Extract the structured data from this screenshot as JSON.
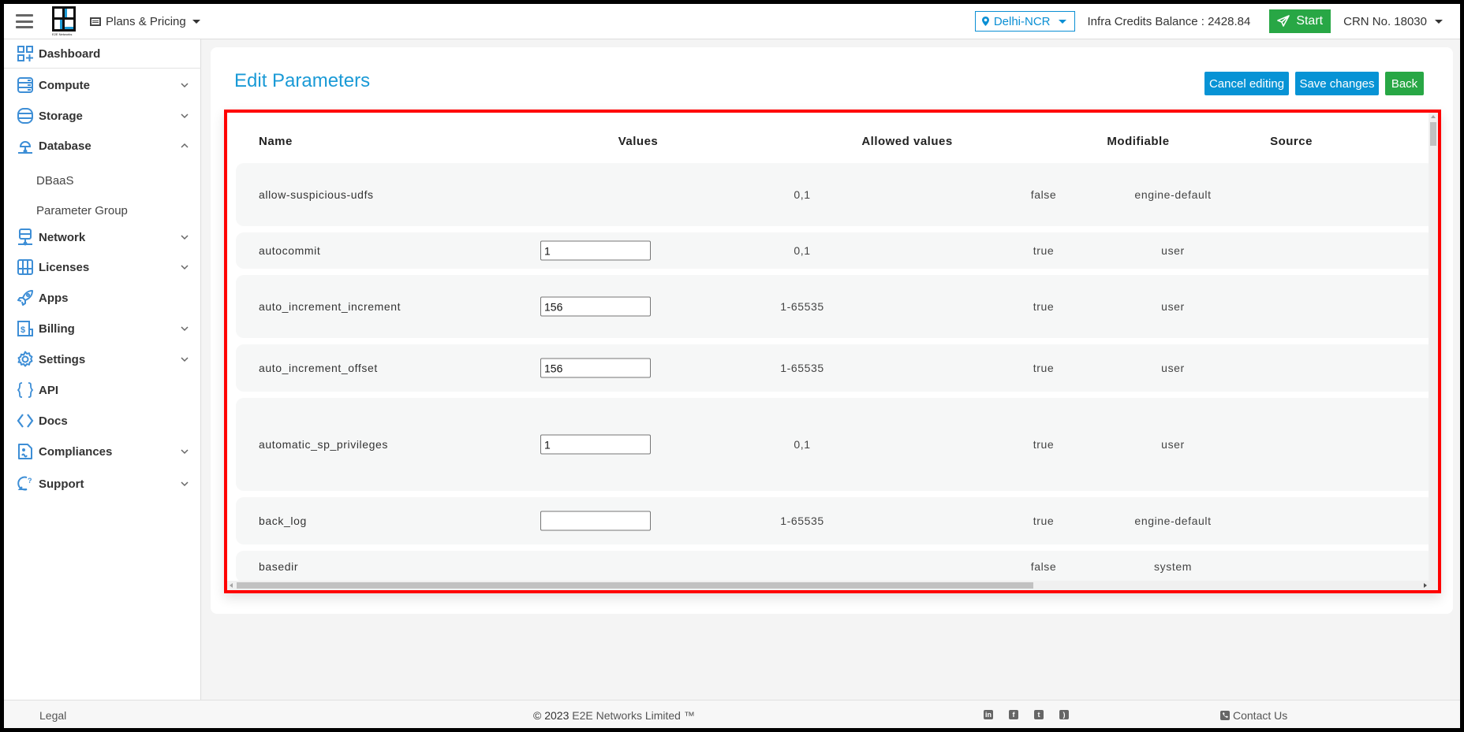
{
  "navbar": {
    "logo_text": "E2E Networks",
    "plans_label": "Plans & Pricing",
    "region": "Delhi-NCR",
    "credits": "Infra Credits Balance : 2428.84",
    "start_label": "Start",
    "crn": "CRN No. 18030"
  },
  "sidebar": {
    "items": [
      {
        "label": "Dashboard",
        "icon": "dashboard-icon"
      },
      {
        "label": "Compute",
        "icon": "server-icon"
      },
      {
        "label": "Storage",
        "icon": "database-stack-icon"
      },
      {
        "label": "Database",
        "icon": "cloud-network-icon"
      },
      {
        "label": "Network",
        "icon": "network-icon"
      },
      {
        "label": "Licenses",
        "icon": "license-icon"
      },
      {
        "label": "Apps",
        "icon": "rocket-icon"
      },
      {
        "label": "Billing",
        "icon": "billing-icon"
      },
      {
        "label": "Settings",
        "icon": "gear-icon"
      },
      {
        "label": "API",
        "icon": "braces-icon"
      },
      {
        "label": "Docs",
        "icon": "code-icon"
      },
      {
        "label": "Compliances",
        "icon": "document-icon"
      },
      {
        "label": "Support",
        "icon": "support-icon"
      }
    ],
    "database_subitems": [
      "DBaaS",
      "Parameter Group"
    ]
  },
  "main": {
    "title": "Edit Parameters",
    "buttons": {
      "cancel": "Cancel editing",
      "save": "Save changes",
      "back": "Back"
    },
    "table": {
      "columns": [
        "Name",
        "Values",
        "Allowed values",
        "Modifiable",
        "Source"
      ],
      "rows": [
        {
          "name": "allow-suspicious-udfs",
          "value": null,
          "allowed": "0,1",
          "modifiable": "false",
          "source": "engine-default"
        },
        {
          "name": "autocommit",
          "value": "1",
          "allowed": "0,1",
          "modifiable": "true",
          "source": "user"
        },
        {
          "name": "auto_increment_increment",
          "value": "156",
          "allowed": "1-65535",
          "modifiable": "true",
          "source": "user"
        },
        {
          "name": "auto_increment_offset",
          "value": "156",
          "allowed": "1-65535",
          "modifiable": "true",
          "source": "user"
        },
        {
          "name": "automatic_sp_privileges",
          "value": "1",
          "allowed": "0,1",
          "modifiable": "true",
          "source": "user"
        },
        {
          "name": "back_log",
          "value": "",
          "allowed": "1-65535",
          "modifiable": "true",
          "source": "engine-default"
        },
        {
          "name": "basedir",
          "value": null,
          "allowed": "",
          "modifiable": "false",
          "source": "system"
        }
      ]
    }
  },
  "footer": {
    "legal": "Legal",
    "copyright_prefix": "© 2023",
    "copyright_brand": "E2E Networks Limited ™",
    "social": [
      "linkedin-icon",
      "facebook-icon",
      "twitter-icon",
      "rss-icon"
    ],
    "contact": "Contact Us"
  },
  "colors": {
    "accent_blue": "#0793d5",
    "accent_green": "#28a745",
    "highlight_border": "#ff0000",
    "title_blue": "#1a9ad6"
  }
}
